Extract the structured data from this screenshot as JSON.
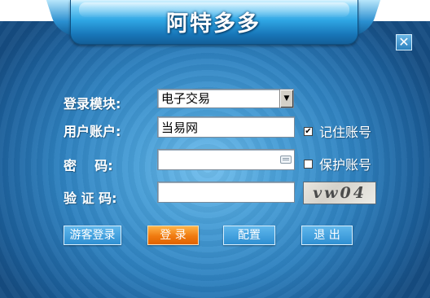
{
  "title": "阿特多多",
  "close_glyph": "✕",
  "form": {
    "module": {
      "label": "登录模块:",
      "value": "电子交易"
    },
    "account": {
      "label": "用户账户:",
      "value": "当易网"
    },
    "password": {
      "label": "密    码:",
      "value": ""
    },
    "captcha": {
      "label": "验 证 码:",
      "value": "",
      "image_text": "vw04"
    }
  },
  "options": {
    "remember": {
      "label": "记住账号",
      "checked": true
    },
    "protect": {
      "label": "保护账号",
      "checked": false
    }
  },
  "buttons": {
    "guest": "游客登录",
    "login": "登  录",
    "config": "配置",
    "exit": "退 出"
  },
  "colors": {
    "accent": "#2e8fd2",
    "login_button": "#f07a10"
  },
  "icons": {
    "close": "close-icon",
    "dropdown": "chevron-down-icon",
    "keyboard": "keyboard-icon"
  }
}
